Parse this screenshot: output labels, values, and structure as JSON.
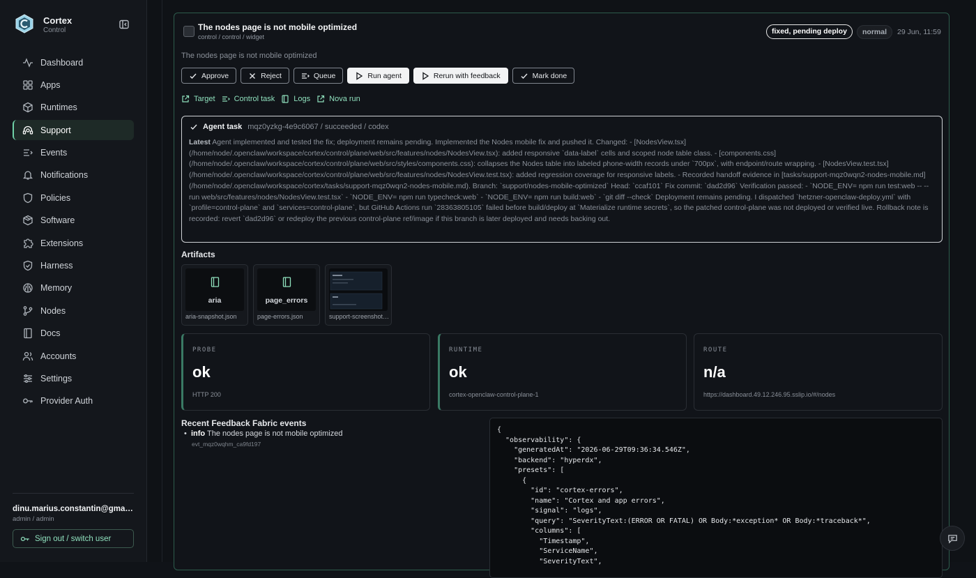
{
  "app": {
    "name": "Cortex",
    "subtitle": "Control"
  },
  "sidebar": {
    "items": [
      {
        "label": "Dashboard",
        "icon": "activity-icon"
      },
      {
        "label": "Apps",
        "icon": "grid-icon"
      },
      {
        "label": "Runtimes",
        "icon": "cube-icon"
      },
      {
        "label": "Support",
        "icon": "support-icon",
        "active": true
      },
      {
        "label": "Events",
        "icon": "list-icon"
      },
      {
        "label": "Notifications",
        "icon": "bell-icon"
      },
      {
        "label": "Policies",
        "icon": "shield-icon"
      },
      {
        "label": "Software",
        "icon": "package-icon"
      },
      {
        "label": "Extensions",
        "icon": "puzzle-icon"
      },
      {
        "label": "Harness",
        "icon": "shield-check-icon"
      },
      {
        "label": "Memory",
        "icon": "brain-icon"
      },
      {
        "label": "Nodes",
        "icon": "git-branch-icon"
      },
      {
        "label": "Docs",
        "icon": "book-icon"
      },
      {
        "label": "Accounts",
        "icon": "users-icon"
      },
      {
        "label": "Settings",
        "icon": "sliders-icon"
      },
      {
        "label": "Provider Auth",
        "icon": "key-icon"
      }
    ]
  },
  "user": {
    "email": "dinu.marius.constantin@gmail.com",
    "role": "admin / admin",
    "signout_label": "Sign out / switch user"
  },
  "ticket": {
    "title": "The nodes page is not mobile optimized",
    "breadcrumb": "control / control / widget",
    "status_badge": "fixed, pending deploy",
    "priority_badge": "normal",
    "date": "29 Jun, 11:59",
    "description": "The nodes page is not mobile optimized"
  },
  "actions": {
    "approve": "Approve",
    "reject": "Reject",
    "queue": "Queue",
    "run_agent": "Run agent",
    "rerun": "Rerun with feedback",
    "mark_done": "Mark done"
  },
  "links": {
    "target": "Target",
    "control_task": "Control task",
    "logs": "Logs",
    "nova_run": "Nova run"
  },
  "agent_task": {
    "label": "Agent task",
    "meta": "mqz0yzkg-4e9c6067 / succeeded / codex",
    "latest_label": "Latest",
    "body": "Agent implemented and tested the fix; deployment remains pending. Implemented the Nodes mobile fix and pushed it. Changed: - [NodesView.tsx](/home/node/.openclaw/workspace/cortex/control/plane/web/src/features/nodes/NodesView.tsx): added responsive `data-label` cells and scoped node table class. - [components.css](/home/node/.openclaw/workspace/cortex/control/plane/web/src/styles/components.css): collapses the Nodes table into labeled phone-width records under `700px`, with endpoint/route wrapping. - [NodesView.test.tsx](/home/node/.openclaw/workspace/cortex/control/plane/web/src/features/nodes/NodesView.test.tsx): added regression coverage for responsive labels. - Recorded handoff evidence in [tasks/support-mqz0wqn2-nodes-mobile.md](/home/node/.openclaw/workspace/cortex/tasks/support-mqz0wqn2-nodes-mobile.md). Branch: `support/nodes-mobile-optimized` Head: `ccaf101` Fix commit: `dad2d96` Verification passed: - `NODE_ENV= npm run test:web -- --run web/src/features/nodes/NodesView.test.tsx` - `NODE_ENV= npm run typecheck:web` - `NODE_ENV= npm run build:web` - `git diff --check` Deployment remains pending. I dispatched `hetzner-openclaw-deploy.yml` with `profile=control-plane` and `services=control-plane`, but GitHub Actions run `28363805105` failed before build/deploy at `Materialize runtime secrets`, so the patched control-plane was not deployed or verified live. Rollback note is recorded: revert `dad2d96` or redeploy the previous control-plane ref/image if this branch is later deployed and needs backing out."
  },
  "artifacts": {
    "title": "Artifacts",
    "items": [
      {
        "name": "aria",
        "file": "aria-snapshot.json"
      },
      {
        "name": "page_errors",
        "file": "page-errors.json"
      },
      {
        "name": "",
        "file": "support-screenshot.png"
      }
    ]
  },
  "stats": [
    {
      "label": "PROBE",
      "value": "ok",
      "sub": "HTTP 200"
    },
    {
      "label": "RUNTIME",
      "value": "ok",
      "sub": "cortex-openclaw-control-plane-1"
    },
    {
      "label": "ROUTE",
      "value": "n/a",
      "sub": "https://dashboard.49.12.246.95.sslip.io/#/nodes"
    }
  ],
  "events": {
    "title": "Recent Feedback Fabric events",
    "items": [
      {
        "level": "info",
        "text": "The nodes page is not mobile optimized",
        "id": "evt_mqz0wqhm_ca9fd197"
      }
    ]
  },
  "code": "{\n  \"observability\": {\n    \"generatedAt\": \"2026-06-29T09:36:34.546Z\",\n    \"backend\": \"hyperdx\",\n    \"presets\": [\n      {\n        \"id\": \"cortex-errors\",\n        \"name\": \"Cortex and app errors\",\n        \"signal\": \"logs\",\n        \"query\": \"SeverityText:(ERROR OR FATAL) OR Body:*exception* OR Body:*traceback*\",\n        \"columns\": [\n          \"Timestamp\",\n          \"ServiceName\",\n          \"SeverityText\","
}
